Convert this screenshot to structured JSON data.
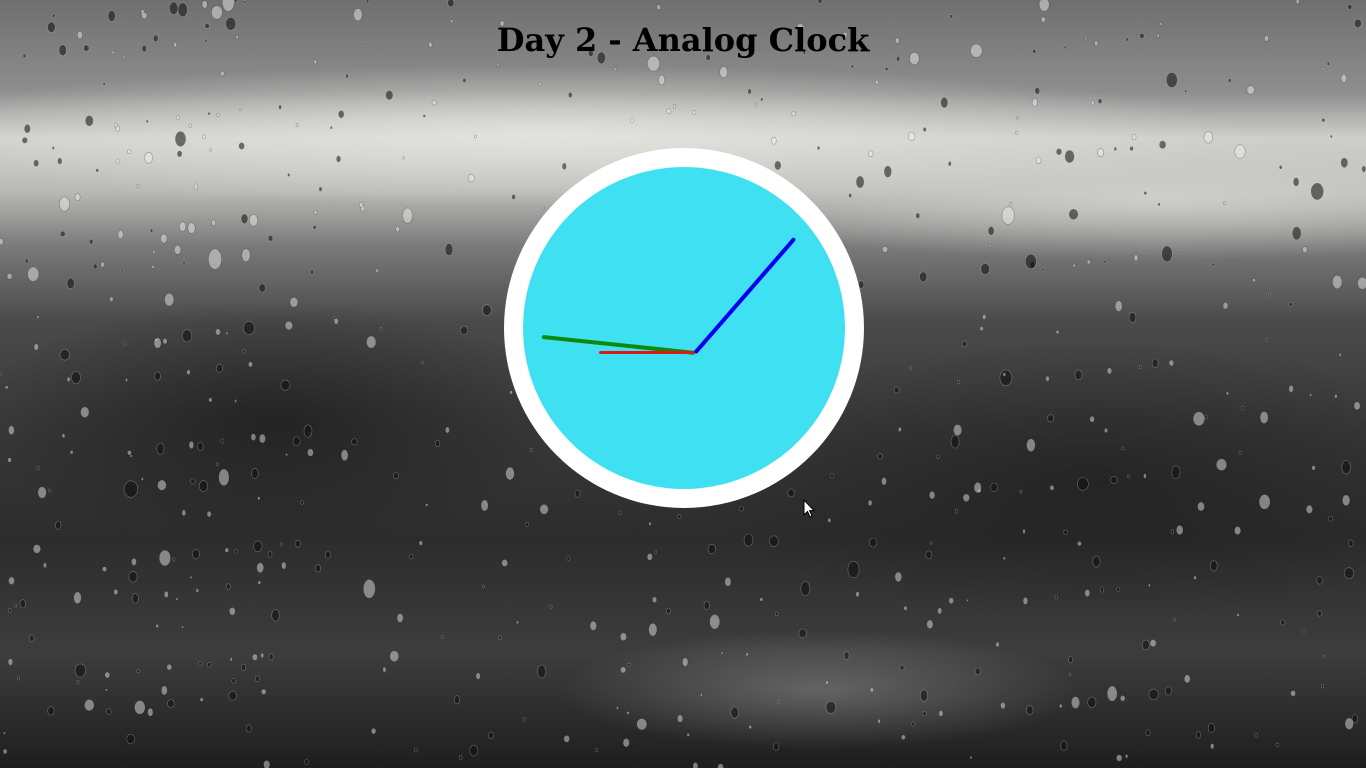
{
  "page": {
    "title": "Day 2 - Analog Clock"
  },
  "clock": {
    "ring_color": "#ffffff",
    "face_color": "#40e0f3",
    "hands": {
      "hour": {
        "color": "#e0161b",
        "angle_deg": 270
      },
      "minute": {
        "color": "#0b8a0b",
        "angle_deg": 276
      },
      "second": {
        "color": "#0000f0",
        "angle_deg": 41
      }
    }
  },
  "background": {
    "description_icon": "rainy-window-icon"
  },
  "cursor": {
    "icon": "mouse-pointer-icon"
  }
}
